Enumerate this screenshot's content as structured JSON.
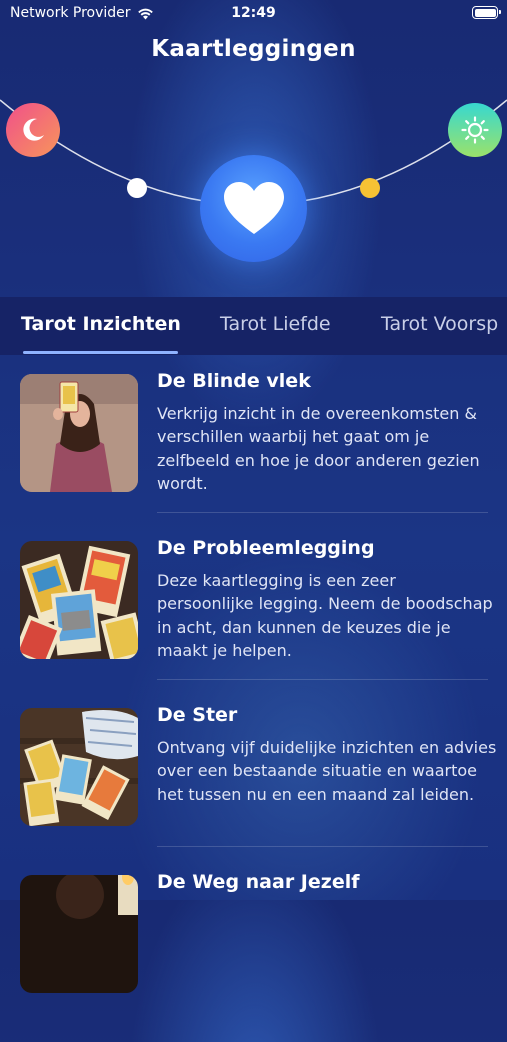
{
  "status_bar": {
    "provider": "Network Provider",
    "time": "12:49"
  },
  "header": {
    "title": "Kaartleggingen"
  },
  "hero": {
    "moon_color": "#f0508a",
    "sun_color": "#37d8d0",
    "heart_color": "#3a79f2",
    "dot_colors": [
      "#ffffff",
      "#f6c234"
    ],
    "icons": [
      "moon-icon",
      "sun-icon",
      "heart-icon"
    ]
  },
  "tabs": [
    {
      "label": "Tarot Inzichten",
      "active": true
    },
    {
      "label": "Tarot Liefde",
      "active": false
    },
    {
      "label": "Tarot Voorsp",
      "active": false
    }
  ],
  "spreads": [
    {
      "title": "De Blinde vlek",
      "desc": "Verkrijg inzicht in de overeenkomsten & verschillen waarbij het gaat om je zelfbeeld en hoe je door anderen gezien wordt."
    },
    {
      "title": "De Probleemlegging",
      "desc": "Deze kaartlegging is een zeer persoonlijke legging. Neem de boodschap in acht, dan kunnen de keuzes die je maakt je helpen."
    },
    {
      "title": "De Ster",
      "desc": "Ontvang vijf duidelijke inzichten en advies over een bestaande situatie en waartoe het tussen nu en een maand zal leiden."
    },
    {
      "title": "De Weg naar Jezelf",
      "desc": ""
    }
  ]
}
